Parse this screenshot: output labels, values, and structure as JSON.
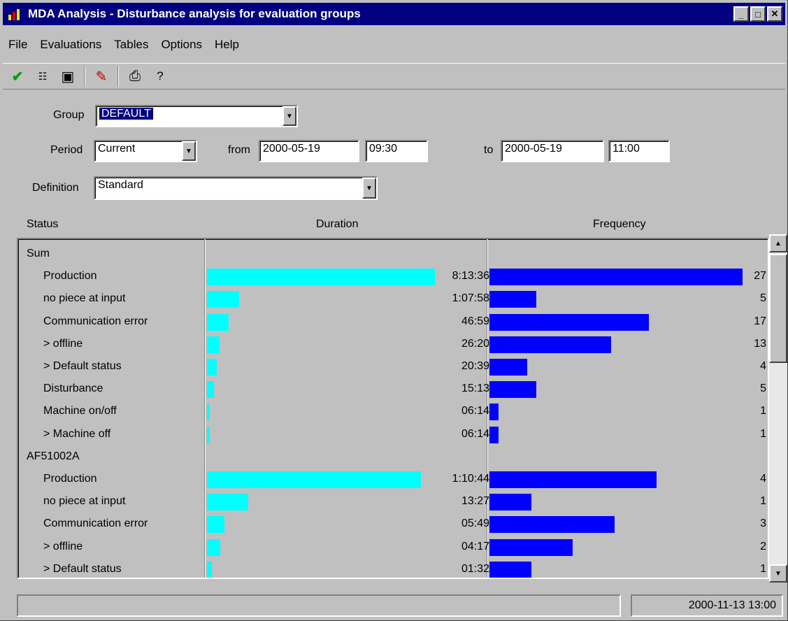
{
  "window": {
    "title": "MDA Analysis - Disturbance analysis for evaluation groups",
    "minimize": "_",
    "maximize": "□",
    "close": "✕"
  },
  "menu": [
    "File",
    "Evaluations",
    "Tables",
    "Options",
    "Help"
  ],
  "toolbar": {
    "help_label": "?"
  },
  "filters": {
    "group_label": "Group",
    "group_value": "DEFAULT",
    "period_label": "Period",
    "period_value": "Current",
    "from_label": "from",
    "from_date": "2000-05-19",
    "from_time": "09:30",
    "to_label": "to",
    "to_date": "2000-05-19",
    "to_time": "11:00",
    "definition_label": "Definition",
    "definition_value": "Standard"
  },
  "columns": {
    "status": "Status",
    "duration": "Duration",
    "frequency": "Frequency"
  },
  "rows": [
    {
      "status": "Sum",
      "indent": 0,
      "duration": "",
      "duration_fraction": 0,
      "frequency": "",
      "frequency_fraction": 0
    },
    {
      "status": "Production",
      "indent": 1,
      "duration": "8:13:36",
      "duration_fraction": 1.0,
      "frequency": "27",
      "frequency_fraction": 1.0
    },
    {
      "status": "no piece at input",
      "indent": 1,
      "duration": "1:07:58",
      "duration_fraction": 0.14,
      "frequency": "5",
      "frequency_fraction": 0.185
    },
    {
      "status": "Communication error",
      "indent": 1,
      "duration": "46:59",
      "duration_fraction": 0.095,
      "frequency": "17",
      "frequency_fraction": 0.63
    },
    {
      "status": "> offline",
      "indent": 1,
      "duration": "26:20",
      "duration_fraction": 0.055,
      "frequency": "13",
      "frequency_fraction": 0.48
    },
    {
      "status": "> Default status",
      "indent": 1,
      "duration": "20:39",
      "duration_fraction": 0.042,
      "frequency": "4",
      "frequency_fraction": 0.148
    },
    {
      "status": "Disturbance",
      "indent": 1,
      "duration": "15:13",
      "duration_fraction": 0.031,
      "frequency": "5",
      "frequency_fraction": 0.185
    },
    {
      "status": "Machine on/off",
      "indent": 1,
      "duration": "06:14",
      "duration_fraction": 0.013,
      "frequency": "1",
      "frequency_fraction": 0.037
    },
    {
      "status": "> Machine off",
      "indent": 1,
      "duration": "06:14",
      "duration_fraction": 0.013,
      "frequency": "1",
      "frequency_fraction": 0.037
    },
    {
      "status": "AF51002A",
      "indent": 0,
      "duration": "",
      "duration_fraction": 0,
      "frequency": "",
      "frequency_fraction": 0
    },
    {
      "status": "Production",
      "indent": 1,
      "duration": "1:10:44",
      "duration_fraction": 0.94,
      "frequency": "4",
      "frequency_fraction": 0.66
    },
    {
      "status": "no piece at input",
      "indent": 1,
      "duration": "13:27",
      "duration_fraction": 0.18,
      "frequency": "1",
      "frequency_fraction": 0.165
    },
    {
      "status": "Communication error",
      "indent": 1,
      "duration": "05:49",
      "duration_fraction": 0.078,
      "frequency": "3",
      "frequency_fraction": 0.495
    },
    {
      "status": "> offline",
      "indent": 1,
      "duration": "04:17",
      "duration_fraction": 0.057,
      "frequency": "2",
      "frequency_fraction": 0.33
    },
    {
      "status": "> Default status",
      "indent": 1,
      "duration": "01:32",
      "duration_fraction": 0.02,
      "frequency": "1",
      "frequency_fraction": 0.165
    }
  ],
  "statusbar": {
    "message": "",
    "datetime": "2000-11-13 13:00"
  },
  "colors": {
    "duration_bar": "#00ffff",
    "frequency_bar": "#0000ff",
    "titlebar": "#000080"
  }
}
